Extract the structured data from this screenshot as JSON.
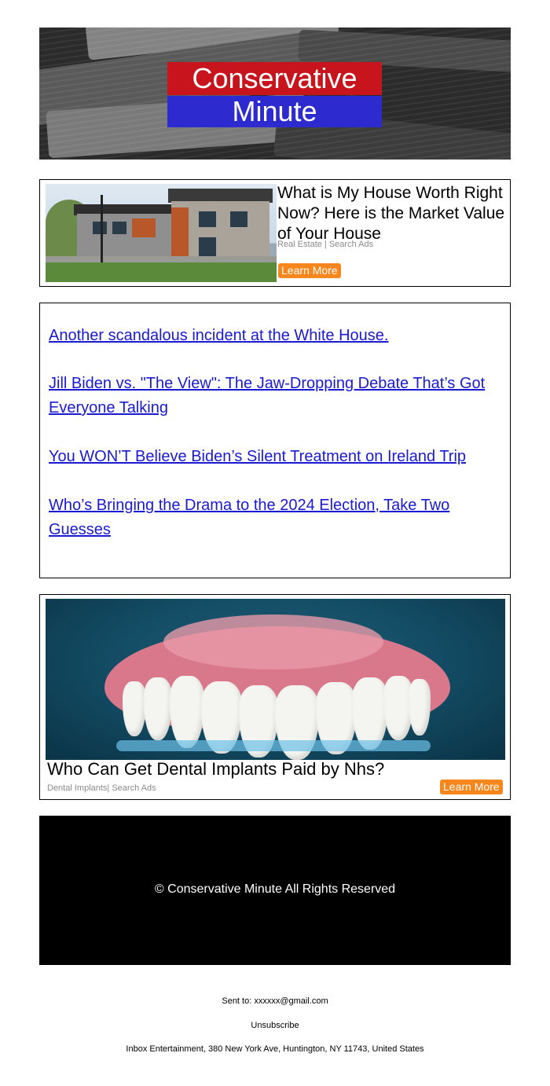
{
  "header": {
    "logo_line1": "Conservative",
    "logo_line2": "Minute",
    "logo_colors": {
      "top": "#c8141c",
      "bottom": "#2d2bd0"
    }
  },
  "ad_house": {
    "image": "house-photo",
    "title": "What is My House Worth Right Now? Here is the Market Value of Your House",
    "meta": "Real Estate | Search Ads",
    "button_label": "Learn More"
  },
  "links": [
    {
      "text": "Another scandalous incident at the White House."
    },
    {
      "text": "Jill Biden vs. \"The View\": The Jaw-Dropping Debate That’s Got Everyone Talking"
    },
    {
      "text": "You WON’T Believe Biden’s Silent Treatment on Ireland Trip"
    },
    {
      "text": "Who’s Bringing the Drama to the 2024 Election, Take Two Guesses"
    }
  ],
  "ad_dental": {
    "image": "dentures-photo",
    "title": "Who Can Get Dental Implants Paid by Nhs?",
    "meta": "Dental Implants| Search Ads",
    "button_label": "Learn More"
  },
  "footer": {
    "copyright": "© Conservative Minute All Rights Reserved"
  },
  "email_meta": {
    "sent_to": "Sent to: xxxxxx@gmail.com",
    "unsubscribe": "Unsubscribe",
    "address": "Inbox Entertainment, 380 New York Ave, Huntington, NY 11743, United States"
  },
  "colors": {
    "link": "#1a1ad2",
    "button": "#f7861c",
    "footer_bg": "#000000"
  }
}
